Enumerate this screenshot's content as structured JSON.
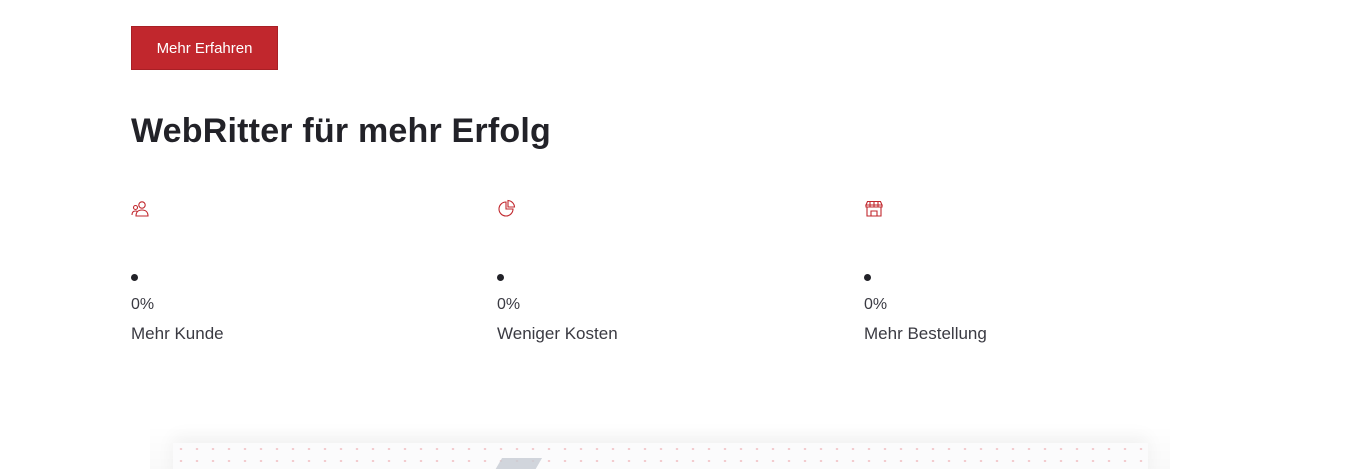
{
  "cta": {
    "label": "Mehr Erfahren"
  },
  "section": {
    "title": "WebRitter für mehr Erfolg"
  },
  "colors": {
    "accent": "#c1272d",
    "text": "#2b2b33",
    "icon": "#c1272d"
  },
  "stats": [
    {
      "icon": "users-icon",
      "value": "0%",
      "label": "Mehr Kunde"
    },
    {
      "icon": "pie-chart-icon",
      "value": "0%",
      "label": "Weniger Kosten"
    },
    {
      "icon": "store-icon",
      "value": "0%",
      "label": "Mehr Bestellung"
    }
  ]
}
